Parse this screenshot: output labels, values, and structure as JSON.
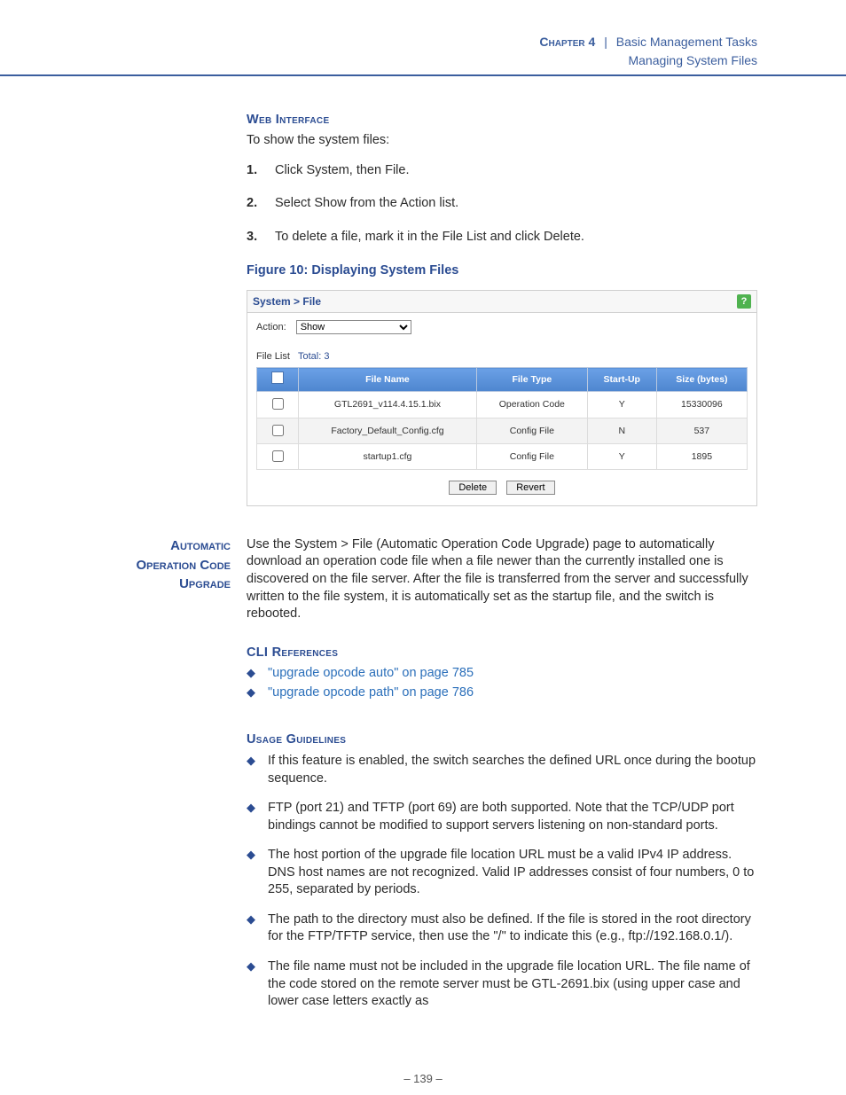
{
  "header": {
    "chapter_label": "Chapter 4",
    "separator": "|",
    "chapter_title": "Basic Management Tasks",
    "subtitle": "Managing System Files"
  },
  "web_interface": {
    "heading": "Web Interface",
    "lead": "To show the system files:",
    "steps": [
      "Click System, then File.",
      "Select Show from the Action list.",
      "To delete a file, mark it in the File List and click Delete."
    ]
  },
  "figure": {
    "caption": "Figure 10:  Displaying System Files",
    "breadcrumb": "System > File",
    "help_glyph": "?",
    "action_label": "Action:",
    "action_value": "Show",
    "list_label": "File List",
    "total_label": "Total: 3",
    "columns": [
      "",
      "File Name",
      "File Type",
      "Start-Up",
      "Size (bytes)"
    ],
    "rows": [
      {
        "name": "GTL2691_v114.4.15.1.bix",
        "type": "Operation Code",
        "startup": "Y",
        "size": "15330096"
      },
      {
        "name": "Factory_Default_Config.cfg",
        "type": "Config File",
        "startup": "N",
        "size": "537"
      },
      {
        "name": "startup1.cfg",
        "type": "Config File",
        "startup": "Y",
        "size": "1895"
      }
    ],
    "buttons": {
      "delete": "Delete",
      "revert": "Revert"
    }
  },
  "auto_upgrade": {
    "margin_label_lines": [
      "Automatic",
      "Operation Code",
      "Upgrade"
    ],
    "body": "Use the System > File (Automatic Operation Code Upgrade) page to automatically download an operation code file when a file newer than the currently installed one is discovered on the file server. After the file is transferred from the server and successfully written to the file system, it is automatically set as the startup file, and the switch is rebooted."
  },
  "cli_refs": {
    "heading": "CLI References",
    "items": [
      "\"upgrade opcode auto\" on page 785",
      "\"upgrade opcode path\" on page 786"
    ]
  },
  "usage": {
    "heading": "Usage Guidelines",
    "items": [
      "If this feature is enabled, the switch searches the defined URL once during the bootup sequence.",
      "FTP (port 21) and TFTP (port 69) are both supported. Note that the TCP/UDP port bindings cannot be modified to support servers listening on non-standard ports.",
      "The host portion of the upgrade file location URL must be a valid IPv4 IP address. DNS host names are not recognized. Valid IP addresses consist of four numbers, 0 to 255, separated by periods.",
      "The path to the directory must also be defined. If the file is stored in the root directory for the FTP/TFTP service, then use the \"/\" to indicate this (e.g., ftp://192.168.0.1/).",
      "The file name must not be included in the upgrade file location URL. The file name of the code stored on the remote server must be GTL-2691.bix (using upper case and lower case letters exactly as"
    ]
  },
  "page_number": "–  139  –"
}
